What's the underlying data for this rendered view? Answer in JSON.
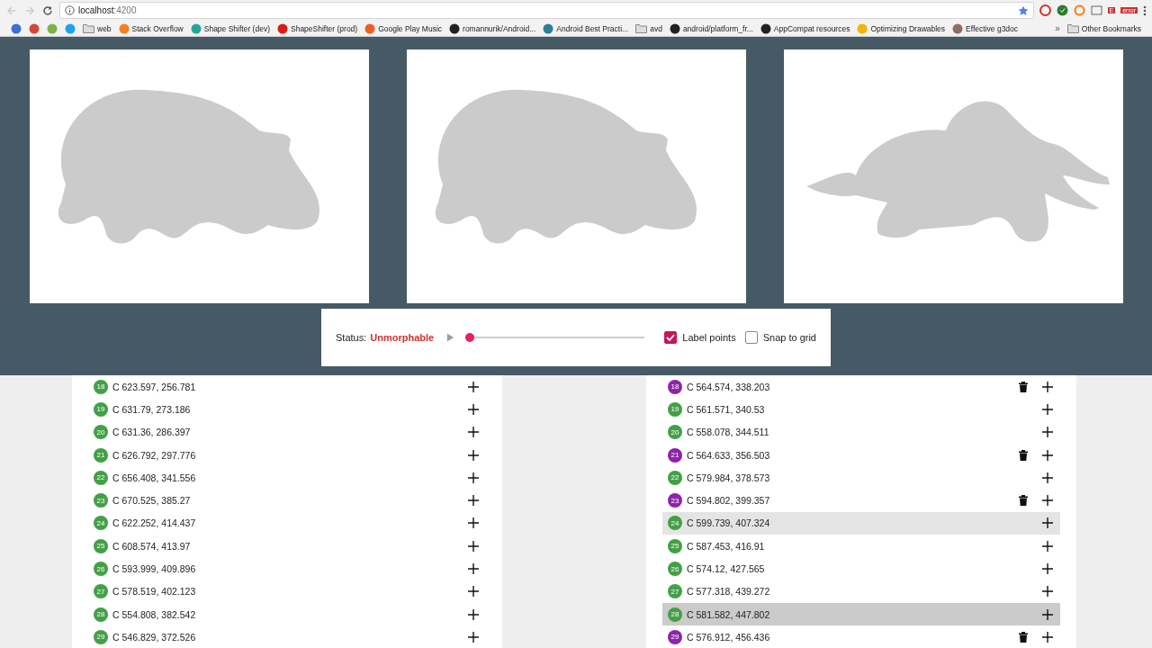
{
  "browser": {
    "url_host": "localhost",
    "url_port": ":4200",
    "bookmarks": [
      {
        "kind": "site",
        "color": "#3b6fd6"
      },
      {
        "kind": "site",
        "color": "#d34836"
      },
      {
        "kind": "site",
        "color": "#7cb342"
      },
      {
        "kind": "site",
        "color": "#1da1f2"
      },
      {
        "kind": "folder",
        "label": "web"
      },
      {
        "kind": "site",
        "color": "#f48024",
        "label": "Stack Overflow"
      },
      {
        "kind": "site",
        "color": "#26a69a",
        "label": "Shape Shifter (dev)"
      },
      {
        "kind": "site",
        "color": "#dd1b16",
        "label": "ShapeShifter (prod)"
      },
      {
        "kind": "site",
        "color": "#ef5c24",
        "label": "Google Play Music"
      },
      {
        "kind": "site",
        "color": "#222222",
        "label": "romannurik/Android..."
      },
      {
        "kind": "site",
        "color": "#2e7d9a",
        "label": "Android Best Practi..."
      },
      {
        "kind": "folder",
        "label": "avd"
      },
      {
        "kind": "site",
        "color": "#222222",
        "label": "android/platform_fr..."
      },
      {
        "kind": "site",
        "color": "#222222",
        "label": "AppCompat resources"
      },
      {
        "kind": "site",
        "color": "#f4b400",
        "label": "Optimizing Drawables"
      },
      {
        "kind": "site",
        "color": "#8d6e63",
        "label": "Effective g3doc"
      }
    ],
    "overflow": "»",
    "other_bookmarks": "Other Bookmarks",
    "ext_badge": "E",
    "ext_error": "error"
  },
  "canvases": [
    {
      "kind": "hippo"
    },
    {
      "kind": "hippo"
    },
    {
      "kind": "elephant"
    }
  ],
  "controls": {
    "status_label": "Status:",
    "status_value": "Unmorphable",
    "slider": {
      "level": 0
    },
    "checkboxes": [
      {
        "label": "Label points",
        "checked": true
      },
      {
        "label": "Snap to grid",
        "checked": false
      }
    ]
  },
  "lists": [
    {
      "rows": [
        {
          "index": "18",
          "command": "C 623.597, 256.781",
          "color": "#43a047",
          "deletable": false,
          "hovered": false,
          "selected": false
        },
        {
          "index": "19",
          "command": "C 631.79, 273.186",
          "color": "#43a047",
          "deletable": false,
          "hovered": false,
          "selected": false
        },
        {
          "index": "20",
          "command": "C 631.36, 286.397",
          "color": "#43a047",
          "deletable": false,
          "hovered": false,
          "selected": false
        },
        {
          "index": "21",
          "command": "C 626.792, 297.776",
          "color": "#43a047",
          "deletable": false,
          "hovered": false,
          "selected": false
        },
        {
          "index": "22",
          "command": "C 656.408, 341.556",
          "color": "#43a047",
          "deletable": false,
          "hovered": false,
          "selected": false
        },
        {
          "index": "23",
          "command": "C 670.525, 385.27",
          "color": "#43a047",
          "deletable": false,
          "hovered": false,
          "selected": false
        },
        {
          "index": "24",
          "command": "C 622.252, 414.437",
          "color": "#43a047",
          "deletable": false,
          "hovered": false,
          "selected": false
        },
        {
          "index": "25",
          "command": "C 608.574, 413.97",
          "color": "#43a047",
          "deletable": false,
          "hovered": false,
          "selected": false
        },
        {
          "index": "26",
          "command": "C 593.999, 409.896",
          "color": "#43a047",
          "deletable": false,
          "hovered": false,
          "selected": false
        },
        {
          "index": "27",
          "command": "C 578.519, 402.123",
          "color": "#43a047",
          "deletable": false,
          "hovered": false,
          "selected": false
        },
        {
          "index": "28",
          "command": "C 554.808, 382.542",
          "color": "#43a047",
          "deletable": false,
          "hovered": false,
          "selected": false
        },
        {
          "index": "29",
          "command": "C 546.829, 372.526",
          "color": "#43a047",
          "deletable": false,
          "hovered": false,
          "selected": false
        }
      ]
    },
    {
      "rows": [
        {
          "index": "18",
          "command": "C 564.574, 338.203",
          "color": "#8e24aa",
          "deletable": true,
          "hovered": false,
          "selected": false
        },
        {
          "index": "19",
          "command": "C 561.571, 340.53",
          "color": "#43a047",
          "deletable": false,
          "hovered": false,
          "selected": false
        },
        {
          "index": "20",
          "command": "C 558.078, 344.511",
          "color": "#43a047",
          "deletable": false,
          "hovered": false,
          "selected": false
        },
        {
          "index": "21",
          "command": "C 564.633, 356.503",
          "color": "#8e24aa",
          "deletable": true,
          "hovered": false,
          "selected": false
        },
        {
          "index": "22",
          "command": "C 579.984, 378.573",
          "color": "#43a047",
          "deletable": false,
          "hovered": false,
          "selected": false
        },
        {
          "index": "23",
          "command": "C 594.802, 399.357",
          "color": "#8e24aa",
          "deletable": true,
          "hovered": false,
          "selected": false
        },
        {
          "index": "24",
          "command": "C 599.739, 407.324",
          "color": "#43a047",
          "deletable": false,
          "hovered": true,
          "selected": false
        },
        {
          "index": "25",
          "command": "C 587.453, 416.91",
          "color": "#43a047",
          "deletable": false,
          "hovered": false,
          "selected": false
        },
        {
          "index": "26",
          "command": "C 574.12, 427.565",
          "color": "#43a047",
          "deletable": false,
          "hovered": false,
          "selected": false
        },
        {
          "index": "27",
          "command": "C 577.318, 439.272",
          "color": "#43a047",
          "deletable": false,
          "hovered": false,
          "selected": false
        },
        {
          "index": "28",
          "command": "C 581.582, 447.802",
          "color": "#43a047",
          "deletable": false,
          "hovered": false,
          "selected": true
        },
        {
          "index": "29",
          "command": "C 576.912, 456.436",
          "color": "#8e24aa",
          "deletable": true,
          "hovered": false,
          "selected": false
        }
      ]
    }
  ]
}
